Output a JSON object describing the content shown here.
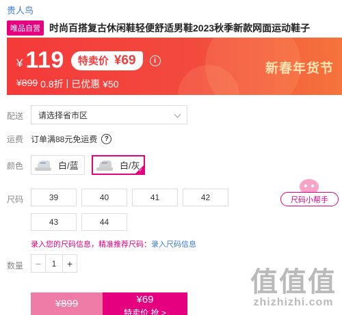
{
  "brand": "贵人鸟",
  "title": {
    "tag": "唯品自营",
    "text": "时尚百搭复古休闲鞋轻便舒适男鞋2023秋季新款网面运动鞋子"
  },
  "banner": {
    "currency": "¥",
    "price": "119",
    "hot_label": "特卖价",
    "hot_price": "¥69",
    "original_price": "¥899",
    "discount": "0.8折",
    "separator": "|",
    "saved": "已优惠 ¥50",
    "festival": "新春年货节",
    "info_icon": "info-icon"
  },
  "delivery": {
    "label": "配送",
    "placeholder": "请选择省市区"
  },
  "shipping": {
    "label": "运费",
    "text": "订单满88元免运费",
    "help_icon": "question-icon"
  },
  "color": {
    "label": "颜色",
    "options": [
      {
        "label": "白/蓝",
        "selected": false
      },
      {
        "label": "白/灰",
        "selected": true
      }
    ],
    "accent": "#e4007f"
  },
  "size": {
    "label": "尺码",
    "options": [
      "39",
      "40",
      "41",
      "42",
      "43",
      "44"
    ],
    "helper": "尺码小帮手",
    "info_prefix": "录入您的尺码信息，精准推荐尺码：",
    "info_link": "录入尺码信息"
  },
  "quantity": {
    "label": "数量",
    "minus": "−",
    "value": "1",
    "plus": "+"
  },
  "buy": {
    "original": "¥899",
    "price": "¥69",
    "label": "特卖价 抢 >"
  },
  "watermark": {
    "logo": "值值值",
    "url": "zhizhizhi.com"
  },
  "colors": {
    "banner_red": "#f24a3e",
    "brand_pink": "#e4007f",
    "link_blue": "#3a7bd5"
  }
}
